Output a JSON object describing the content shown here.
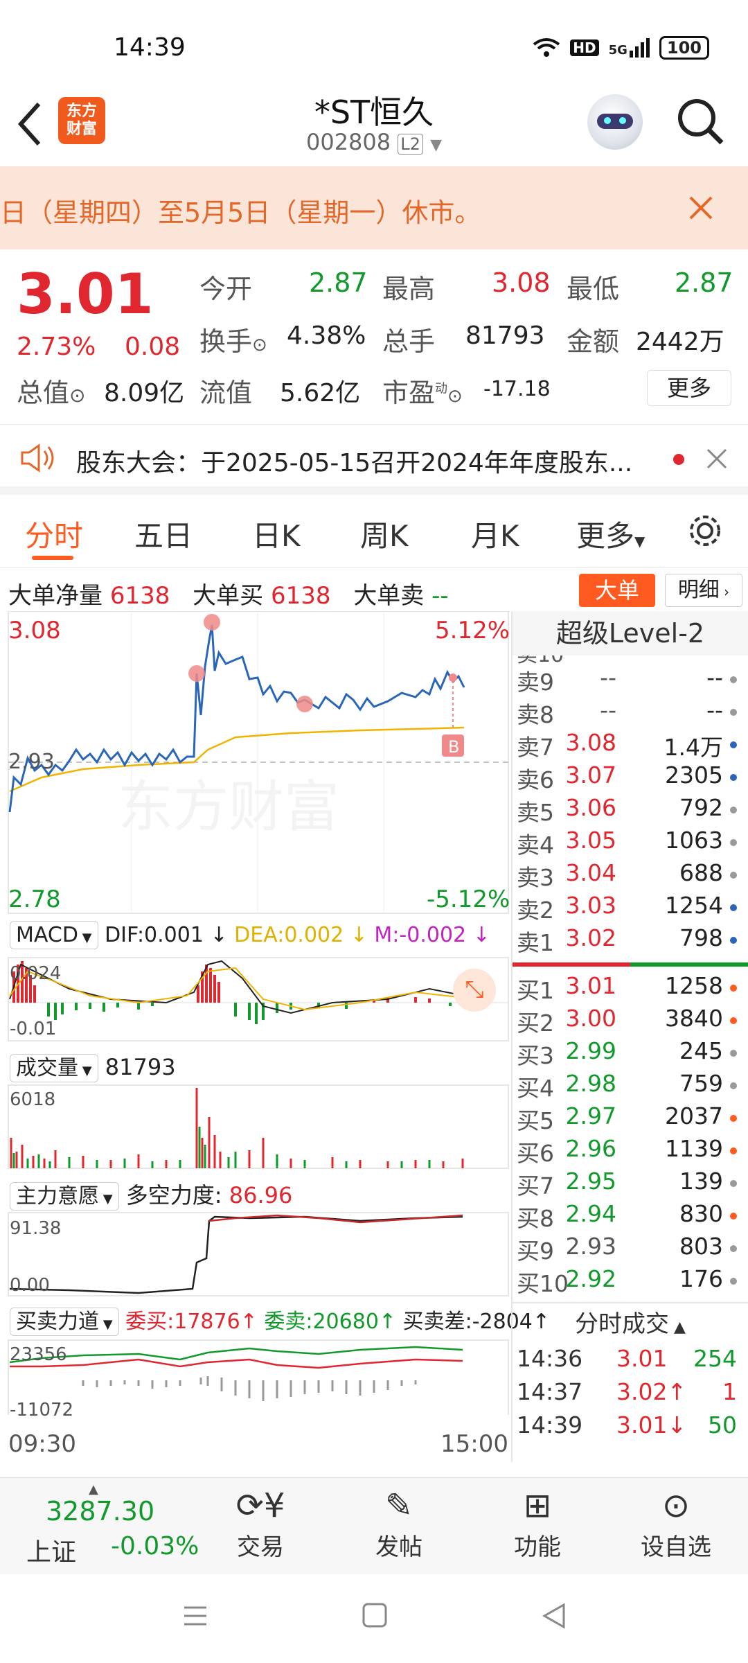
{
  "status": {
    "time": "14:39",
    "hd": "HD",
    "net": "5G",
    "battery": "100"
  },
  "header": {
    "logo": "东方\n财富",
    "title": "*ST恒久",
    "code": "002808",
    "level_badge": "L2"
  },
  "notice": {
    "text": "日（星期四）至5月5日（星期一）休市。"
  },
  "quote": {
    "price": "3.01",
    "pct": "2.73%",
    "change": "0.08",
    "open_label": "今开",
    "open": "2.87",
    "high_label": "最高",
    "high": "3.08",
    "low_label": "最低",
    "low": "2.87",
    "turnover_label": "换手",
    "turnover": "4.38%",
    "vol_label": "总手",
    "vol": "81793",
    "amount_label": "金额",
    "amount": "2442万",
    "mcap_label": "总值",
    "mcap": "8.09亿",
    "float_label": "流值",
    "float": "5.62亿",
    "pe_label": "市盈",
    "pe_sup": "动",
    "pe": "-17.18",
    "more": "更多"
  },
  "meeting": {
    "text": "股东大会：于2025-05-15召开2024年年度股东..."
  },
  "tabs": [
    "分时",
    "五日",
    "日K",
    "周K",
    "月K",
    "更多"
  ],
  "bigorder": {
    "net_label": "大单净量",
    "net": "6138",
    "buy_label": "大单买",
    "buy": "6138",
    "sell_label": "大单卖",
    "sell": "--",
    "btn": "大单",
    "detail": "明细"
  },
  "intraday": {
    "hi": "3.08",
    "lo": "2.78",
    "hi_pct": "5.12%",
    "lo_pct": "-5.12%",
    "ref": "2.93",
    "watermark": "东方财富",
    "marker": "B"
  },
  "macd": {
    "name": "MACD",
    "dif": "DIF:0.001",
    "dea": "DEA:0.002",
    "m": "M:-0.002",
    "top": "0.024",
    "bot": "-0.01"
  },
  "volume": {
    "name": "成交量",
    "val": "81793",
    "top": "6018"
  },
  "main": {
    "name": "主力意愿",
    "label": "多空力度:",
    "val": "86.96",
    "top": "91.38",
    "bot": "0.00"
  },
  "force": {
    "name": "买卖力道",
    "buy": "委买:17876",
    "sell": "委卖:20680",
    "diff": "买卖差:-2804",
    "top": "23356",
    "bot": "-11072"
  },
  "xaxis": {
    "start": "09:30",
    "end": "15:00"
  },
  "orderbook": {
    "title": "超级Level-2",
    "top_partial": "卖10",
    "asks": [
      {
        "l": "卖9",
        "p": "--",
        "v": "--"
      },
      {
        "l": "卖8",
        "p": "--",
        "v": "--"
      },
      {
        "l": "卖7",
        "p": "3.08",
        "v": "1.4万"
      },
      {
        "l": "卖6",
        "p": "3.07",
        "v": "2305"
      },
      {
        "l": "卖5",
        "p": "3.06",
        "v": "792"
      },
      {
        "l": "卖4",
        "p": "3.05",
        "v": "1063"
      },
      {
        "l": "卖3",
        "p": "3.04",
        "v": "688"
      },
      {
        "l": "卖2",
        "p": "3.03",
        "v": "1254"
      },
      {
        "l": "卖1",
        "p": "3.02",
        "v": "798"
      }
    ],
    "bids": [
      {
        "l": "买1",
        "p": "3.01",
        "v": "1258"
      },
      {
        "l": "买2",
        "p": "3.00",
        "v": "3840"
      },
      {
        "l": "买3",
        "p": "2.99",
        "v": "245"
      },
      {
        "l": "买4",
        "p": "2.98",
        "v": "759"
      },
      {
        "l": "买5",
        "p": "2.97",
        "v": "2037"
      },
      {
        "l": "买6",
        "p": "2.96",
        "v": "1139"
      },
      {
        "l": "买7",
        "p": "2.95",
        "v": "139"
      },
      {
        "l": "买8",
        "p": "2.94",
        "v": "830"
      },
      {
        "l": "买9",
        "p": "2.93",
        "v": "803"
      },
      {
        "l": "买10",
        "p": "2.92",
        "v": "176"
      }
    ],
    "ticks_title": "分时成交",
    "ticks": [
      {
        "t": "14:36",
        "p": "3.01",
        "v": "254"
      },
      {
        "t": "14:37",
        "p": "3.02↑",
        "v": "1"
      },
      {
        "t": "14:39",
        "p": "3.01↓",
        "v": "50"
      }
    ]
  },
  "bottomnav": {
    "index_val": "3287.30",
    "index_name": "上证",
    "index_pct": "-0.03%",
    "trade": "交易",
    "post": "发帖",
    "func": "功能",
    "watch": "设自选"
  },
  "colors": {
    "up": "#e0262e",
    "down": "#119a2b",
    "accent": "#ff5a1f",
    "avg": "#f0b400",
    "price": "#2a66b8"
  }
}
